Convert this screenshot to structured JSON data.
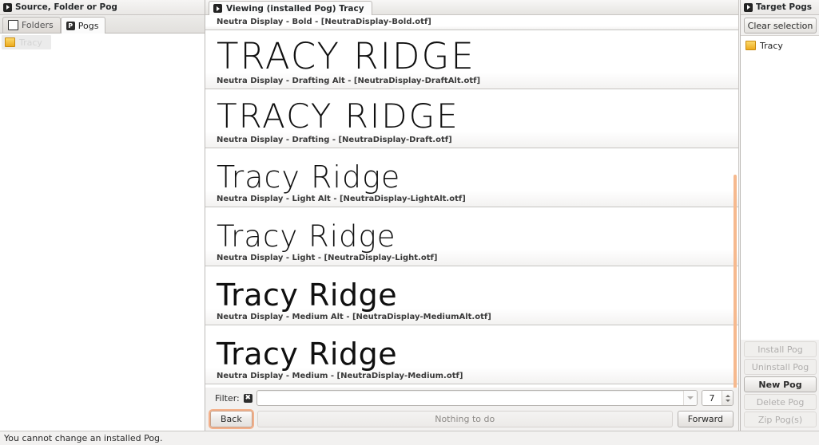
{
  "left_panel": {
    "title": "Source, Folder or Pog",
    "header_icon": "arrow-box-icon",
    "tabs": [
      {
        "label": "Folders",
        "icon": "page-icon",
        "active": false
      },
      {
        "label": "Pogs",
        "icon": "pog-icon",
        "active": true
      }
    ],
    "items": [
      {
        "label": "Tracy",
        "icon": "folder-icon",
        "state": "ghost"
      }
    ]
  },
  "center_panel": {
    "title": "Viewing (installed Pog)  Tracy",
    "header_icon": "arrow-box-icon",
    "rows": [
      {
        "sample": "",
        "meta": "Neutra Display - Bold - [NeutraDisplay-Bold.otf]",
        "clipped": true
      },
      {
        "sample": "TRACY RIDGE",
        "meta": "Neutra Display - Drafting Alt - [NeutraDisplay-DraftAlt.otf]",
        "case": "upper"
      },
      {
        "sample": "TRACY RIDGE",
        "meta": "Neutra Display - Drafting - [NeutraDisplay-Draft.otf]",
        "case": "upper"
      },
      {
        "sample": "Tracy Ridge",
        "meta": "Neutra Display - Light Alt - [NeutraDisplay-LightAlt.otf]",
        "case": "mixed"
      },
      {
        "sample": "Tracy Ridge",
        "meta": "Neutra Display - Light - [NeutraDisplay-Light.otf]",
        "case": "mixed"
      },
      {
        "sample": "Tracy Ridge",
        "meta": "Neutra Display - Medium Alt - [NeutraDisplay-MediumAlt.otf]",
        "case": "mixed"
      },
      {
        "sample": "Tracy Ridge",
        "meta": "Neutra Display - Medium - [NeutraDisplay-Medium.otf]",
        "case": "mixed"
      }
    ],
    "filter": {
      "label": "Filter:",
      "clear_icon": "clear-filter-icon",
      "value": "",
      "placeholder": "",
      "dropdown_icon": "chevron-down-icon",
      "count_value": "7",
      "spinner_icon": "spinner-arrows-icon"
    },
    "nav": {
      "back_label": "Back",
      "status_label": "Nothing to do",
      "forward_label": "Forward"
    }
  },
  "right_panel": {
    "title": "Target Pogs",
    "header_icon": "arrow-box-icon",
    "clear_selection_label": "Clear selection",
    "items": [
      {
        "label": "Tracy",
        "icon": "folder-icon"
      }
    ],
    "actions": [
      {
        "label": "Install Pog",
        "enabled": false
      },
      {
        "label": "Uninstall Pog",
        "enabled": false
      },
      {
        "label": "New Pog",
        "enabled": true
      },
      {
        "label": "Delete Pog",
        "enabled": false
      },
      {
        "label": "Zip Pog(s)",
        "enabled": false
      }
    ]
  },
  "status_bar": {
    "message": "You cannot change an installed Pog."
  },
  "colors": {
    "accent_orange": "#f6b98e",
    "focus_ring": "#f3b08a",
    "folder_yellow": "#edab1e",
    "panel_bg": "#f2f1f0"
  }
}
